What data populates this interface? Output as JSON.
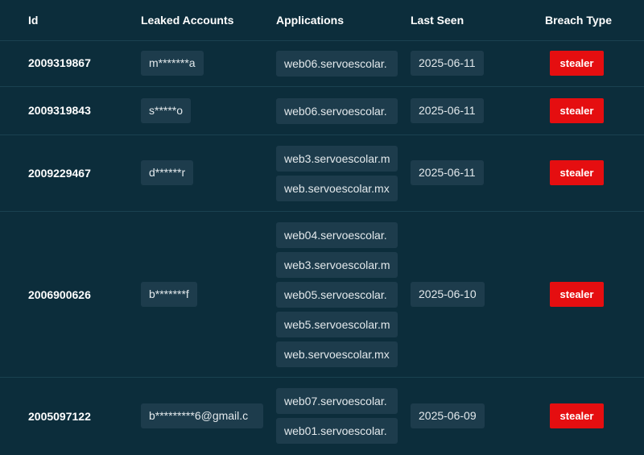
{
  "columns": {
    "id": "Id",
    "accounts": "Leaked Accounts",
    "applications": "Applications",
    "last_seen": "Last Seen",
    "breach_type": "Breach Type"
  },
  "rows": [
    {
      "id": "2009319867",
      "account": "m*******a",
      "applications": [
        "web06.servoescolar."
      ],
      "last_seen": "2025-06-11",
      "breach_type": "stealer"
    },
    {
      "id": "2009319843",
      "account": "s*****o",
      "applications": [
        "web06.servoescolar."
      ],
      "last_seen": "2025-06-11",
      "breach_type": "stealer"
    },
    {
      "id": "2009229467",
      "account": "d******r",
      "applications": [
        "web3.servoescolar.m",
        "web.servoescolar.mx"
      ],
      "last_seen": "2025-06-11",
      "breach_type": "stealer"
    },
    {
      "id": "2006900626",
      "account": "b*******f",
      "applications": [
        "web04.servoescolar.",
        "web3.servoescolar.m",
        "web05.servoescolar.",
        "web5.servoescolar.m",
        "web.servoescolar.mx"
      ],
      "last_seen": "2025-06-10",
      "breach_type": "stealer"
    },
    {
      "id": "2005097122",
      "account": "b*********6@gmail.c",
      "applications": [
        "web07.servoescolar.",
        "web01.servoescolar."
      ],
      "last_seen": "2025-06-09",
      "breach_type": "stealer"
    }
  ],
  "colors": {
    "background": "#0c2d3b",
    "chip": "#1d3c4c",
    "badge": "#e50e10",
    "divider": "#1a4150"
  }
}
